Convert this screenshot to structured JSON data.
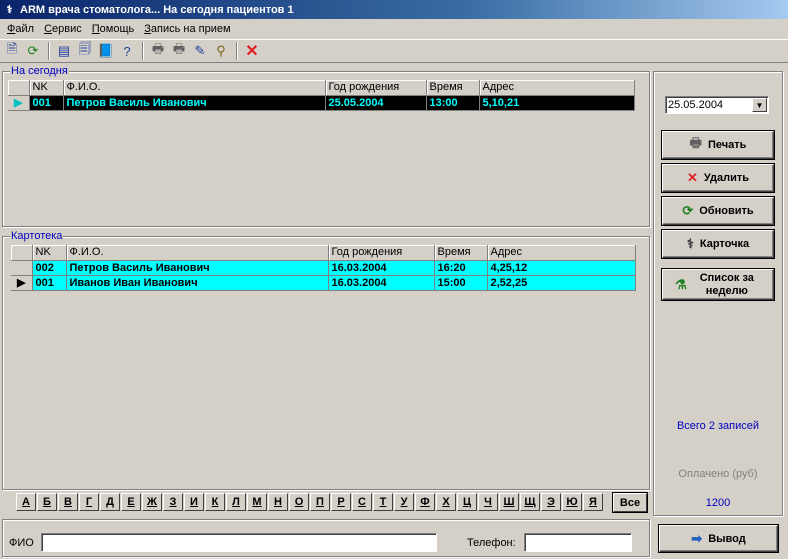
{
  "window": {
    "title": "ARM врача стоматолога... На сегодня пациентов  1"
  },
  "menu": {
    "items": [
      "Файл",
      "Сервис",
      "Помощь",
      "Запись на прием"
    ]
  },
  "today": {
    "title": "На сегодня",
    "columns": [
      "NK",
      "Ф.И.О.",
      "Год рождения",
      "Время",
      "Адрес"
    ],
    "rows": [
      {
        "nk": "001",
        "fio": "Петров Василь Иванович",
        "dob": "25.05.2004",
        "time": "13:00",
        "addr": "5,10,21"
      }
    ]
  },
  "cards": {
    "title": "Картотека",
    "columns": [
      "NK",
      "Ф.И.О.",
      "Год рождения",
      "Время",
      "Адрес"
    ],
    "rows": [
      {
        "nk": "002",
        "fio": "Петров Василь Иванович",
        "dob": "16.03.2004",
        "time": "16:20",
        "addr": "4,25,12"
      },
      {
        "nk": "001",
        "fio": "Иванов Иван Иванович",
        "dob": "16.03.2004",
        "time": "15:00",
        "addr": "2,52,25"
      }
    ]
  },
  "right": {
    "date": "25.05.2004",
    "print": "Печать",
    "delete": "Удалить",
    "refresh": "Обновить",
    "card": "Карточка",
    "week_list": "Список за неделю",
    "total": "Всего 2 записей",
    "paid_label": "Оплачено (руб)",
    "paid_value": "1200",
    "output": "Вывод"
  },
  "letters": [
    "А",
    "Б",
    "В",
    "Г",
    "Д",
    "Е",
    "Ж",
    "З",
    "И",
    "К",
    "Л",
    "М",
    "Н",
    "О",
    "П",
    "Р",
    "С",
    "Т",
    "У",
    "Ф",
    "Х",
    "Ц",
    "Ч",
    "Ш",
    "Щ",
    "Э",
    "Ю",
    "Я"
  ],
  "all_label": "Все",
  "bottom": {
    "fio_label": "ФИО",
    "phone_label": "Телефон:",
    "fio_value": "",
    "phone_value": ""
  },
  "colors": {
    "selected_bg": "#000000",
    "selected_text": "#00ffff",
    "row_bg": "#00ffff",
    "group_title": "#0000c0",
    "info_text": "#0000c0"
  }
}
